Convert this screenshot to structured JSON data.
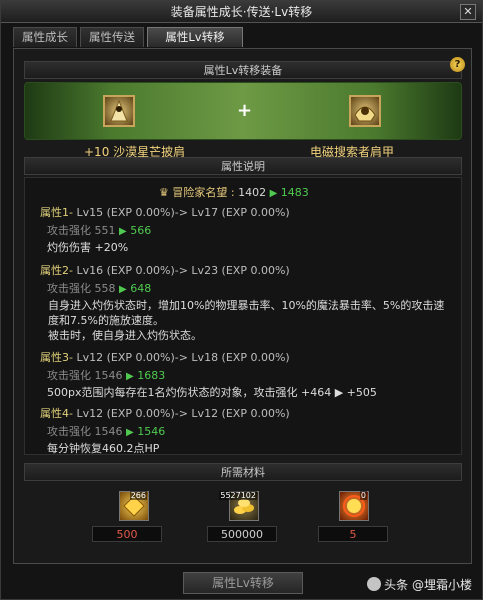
{
  "window": {
    "title": "装备属性成长·传送·Lv转移",
    "close": "✕"
  },
  "tabs": [
    {
      "label": "属性成长"
    },
    {
      "label": "属性传送"
    },
    {
      "label": "属性Lv转移"
    }
  ],
  "transfer": {
    "header": "属性Lv转移装备",
    "help": "?",
    "plus": "+",
    "source_name": "+10 沙漠星芒披肩",
    "target_name": "电磁搜索者肩甲"
  },
  "description": {
    "header": "属性说明",
    "reputation": {
      "label": "冒险家名望 :",
      "from": "1402",
      "to": "1483"
    },
    "attributes": [
      {
        "head": "属性1-",
        "lv": "Lv15 (EXP 0.00%)-> Lv17 (EXP 0.00%)",
        "stat": "攻击强化",
        "stat_from": "551",
        "stat_to": "566",
        "text": [
          "灼伤伤害 +20%"
        ]
      },
      {
        "head": "属性2-",
        "lv": "Lv16 (EXP 0.00%)-> Lv23 (EXP 0.00%)",
        "stat": "攻击强化",
        "stat_from": "558",
        "stat_to": "648",
        "text": [
          "自身进入灼伤状态时，增加10%的物理暴击率、10%的魔法暴击率、5%的攻击速度和7.5%的施放速度。",
          "被击时，使自身进入灼伤状态。"
        ]
      },
      {
        "head": "属性3-",
        "lv": "Lv12 (EXP 0.00%)-> Lv18 (EXP 0.00%)",
        "stat": "攻击强化",
        "stat_from": "1546",
        "stat_to": "1683",
        "text": [
          "500px范围内每存在1名灼伤状态的对象，攻击强化 +464 ▶ +505"
        ]
      },
      {
        "head": "属性4-",
        "lv": "Lv12 (EXP 0.00%)-> Lv12 (EXP 0.00%)",
        "stat": "攻击强化",
        "stat_from": "1546",
        "stat_to": "1546",
        "text": [
          "每分钟恢复460.2点HP"
        ]
      }
    ]
  },
  "materials": {
    "header": "所需材料",
    "items": [
      {
        "icon": "gold-crystal-icon",
        "count": "266",
        "amount": "500",
        "amount_color": "#e05a4a"
      },
      {
        "icon": "gold-coins-icon",
        "count": "5527102",
        "amount": "500000",
        "amount_color": "#cfcfcf"
      },
      {
        "icon": "fire-orb-icon",
        "count": "0",
        "amount": "5",
        "amount_color": "#e05a4a"
      }
    ]
  },
  "action": {
    "label": "属性Lv转移"
  },
  "watermark": {
    "text": "头条 @埋霜小楼"
  }
}
